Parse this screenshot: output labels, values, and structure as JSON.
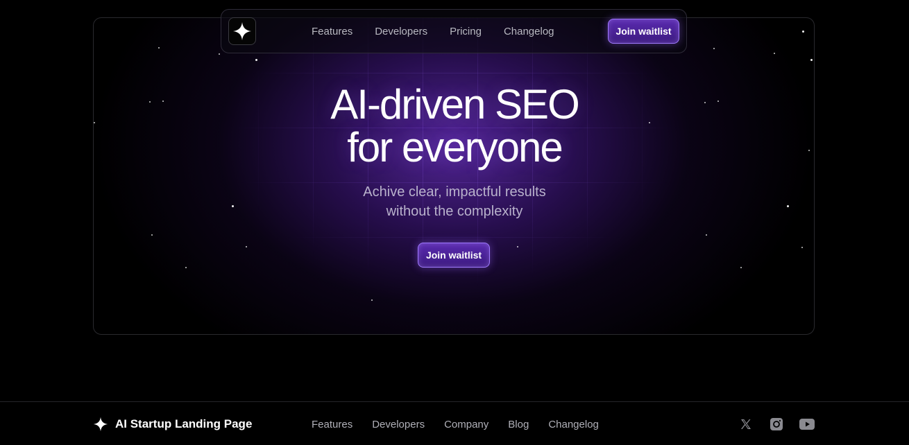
{
  "nav": {
    "links": [
      "Features",
      "Developers",
      "Pricing",
      "Changelog"
    ],
    "cta_label": "Join waitlist",
    "logo_icon": "sparkle-icon"
  },
  "hero": {
    "title_line1": "AI-driven SEO",
    "title_line2": "for everyone",
    "subtitle_line1": "Achive clear, impactful results",
    "subtitle_line2": "without the complexity",
    "cta_label": "Join waitlist"
  },
  "footer": {
    "brand_name": "AI Startup Landing Page",
    "links": [
      "Features",
      "Developers",
      "Company",
      "Blog",
      "Changelog"
    ],
    "socials": [
      "x-icon",
      "instagram-icon",
      "youtube-icon"
    ]
  },
  "colors": {
    "accent": "#5a2bb0",
    "accent_border": "#a07aff",
    "background": "#000000"
  }
}
